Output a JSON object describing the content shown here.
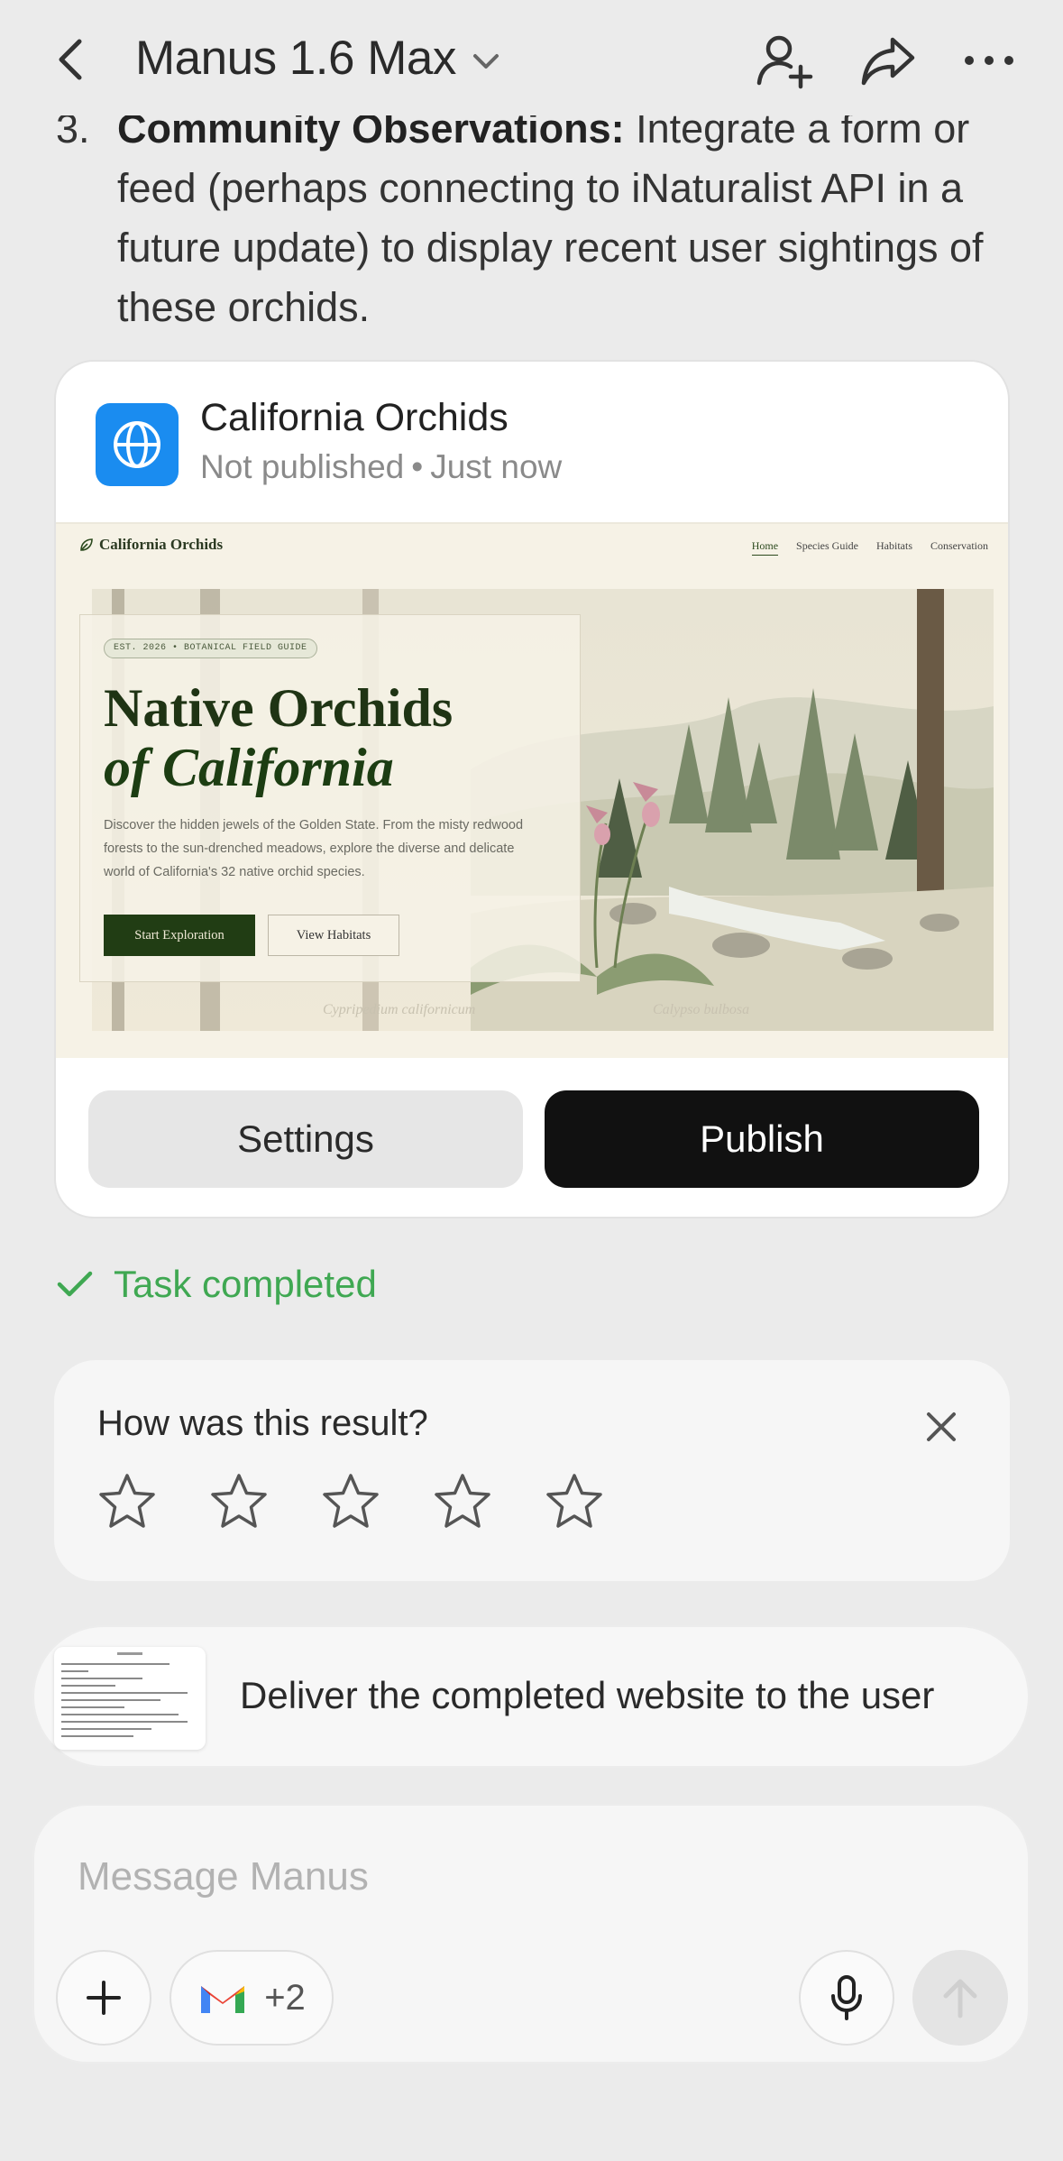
{
  "header": {
    "title": "Manus 1.6 Max",
    "icons": [
      "back-chevron",
      "chevron-down",
      "add-user",
      "share-arrow",
      "more-horizontal"
    ]
  },
  "message": {
    "list_number": "3.",
    "bold_lead": "Community Observations:",
    "text": " Integrate a form or feed (perhaps connecting to iNaturalist API in a future update) to display recent user sightings of these orchids."
  },
  "website_card": {
    "title": "California Orchids",
    "status": "Not published",
    "separator": "•",
    "time": "Just now",
    "icon": "globe",
    "accent": "#1a8cf0",
    "preview": {
      "brand": "California Orchids",
      "nav": [
        "Home",
        "Species Guide",
        "Habitats",
        "Conservation"
      ],
      "badge": "EST. 2026 • BOTANICAL FIELD GUIDE",
      "headline_line1": "Native Orchids",
      "headline_line2": "of California",
      "description": "Discover the hidden jewels of the Golden State. From the misty redwood forests to the sun-drenched meadows, explore the diverse and delicate world of California's 32 native orchid species.",
      "primary_cta": "Start Exploration",
      "secondary_cta": "View Habitats",
      "caption_left": "Cypripedium californicum",
      "caption_right": "Calypso bulbosa"
    },
    "settings_label": "Settings",
    "publish_label": "Publish"
  },
  "task_status": {
    "label": "Task completed",
    "color": "#3fa852"
  },
  "rating": {
    "question": "How was this result?",
    "star_count": 5,
    "selected": 0
  },
  "step": {
    "label": "Deliver the completed website to the user"
  },
  "composer": {
    "placeholder": "Message Manus",
    "connectors_more": "+2",
    "icons": [
      "plus",
      "gmail",
      "microphone",
      "send-arrow"
    ]
  }
}
